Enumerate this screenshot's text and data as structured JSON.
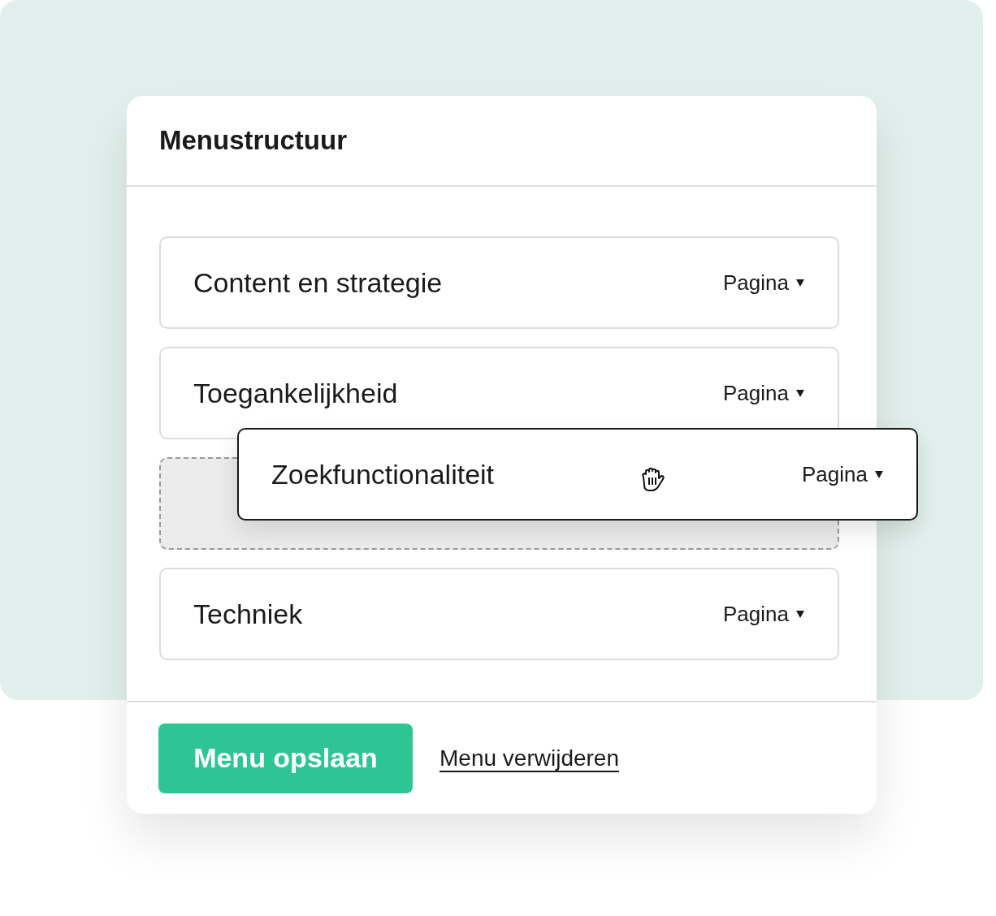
{
  "card": {
    "title": "Menustructuur"
  },
  "items": [
    {
      "kind": "item",
      "title": "Content en strategie",
      "type": "Pagina"
    },
    {
      "kind": "item",
      "title": "Toegankelijkheid",
      "type": "Pagina"
    },
    {
      "kind": "placeholder"
    },
    {
      "kind": "item",
      "title": "Techniek",
      "type": "Pagina"
    }
  ],
  "dragged": {
    "title": "Zoekfunctionaliteit",
    "type": "Pagina"
  },
  "footer": {
    "save_button": "Menu opslaan",
    "delete_link": "Menu verwijderen"
  }
}
